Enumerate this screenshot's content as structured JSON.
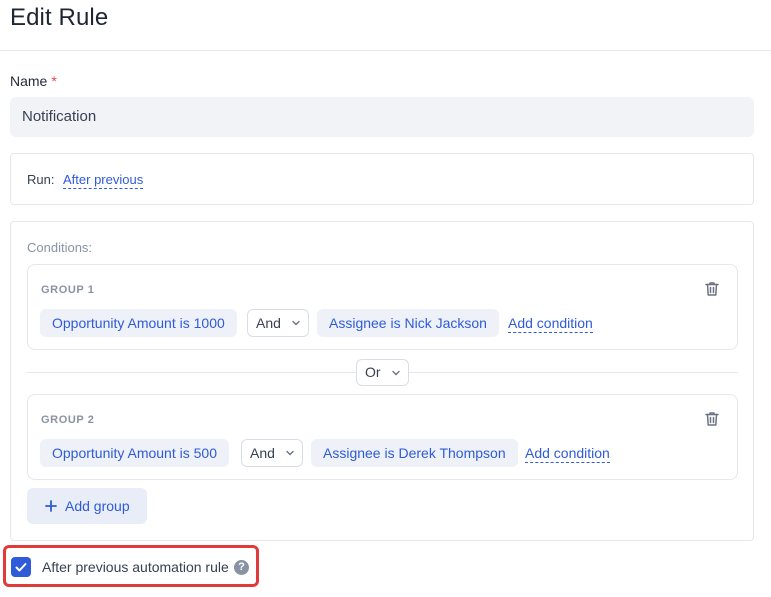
{
  "header": {
    "title": "Edit Rule"
  },
  "name_field": {
    "label": "Name",
    "required_mark": "*",
    "value": "Notification"
  },
  "run": {
    "label": "Run:",
    "value": "After previous"
  },
  "conditions": {
    "label": "Conditions:",
    "groups": [
      {
        "title": "GROUP 1",
        "condition_1": "Opportunity Amount is 1000",
        "operator": "And",
        "condition_2": "Assignee is Nick Jackson",
        "add_condition": "Add condition"
      },
      {
        "title": "GROUP 2",
        "condition_1": "Opportunity Amount is 500",
        "operator": "And",
        "condition_2": "Assignee is Derek Thompson",
        "add_condition": "Add condition"
      }
    ],
    "group_operator": "Or",
    "add_group": "Add group"
  },
  "after_previous": {
    "label": "After previous automation rule",
    "checked": true,
    "help": "?"
  },
  "colors": {
    "accent": "#2f5bd8",
    "highlight_border": "#e03a3a",
    "required": "#ef4444"
  },
  "icons": [
    "trash-icon",
    "chevron-down-icon",
    "plus-icon",
    "checkmark-icon",
    "help-icon"
  ]
}
